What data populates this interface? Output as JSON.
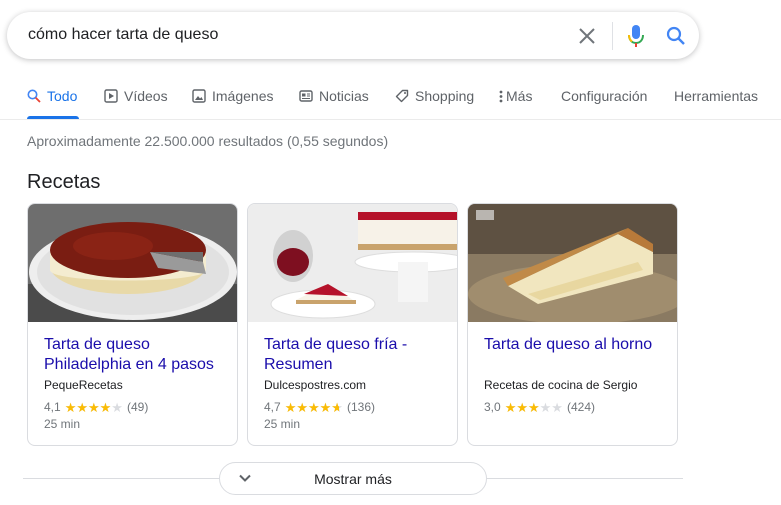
{
  "search": {
    "query": "cómo hacer tarta de queso"
  },
  "tabs": [
    {
      "label": "Todo",
      "icon": "search-icon"
    },
    {
      "label": "Vídeos",
      "icon": "play-icon"
    },
    {
      "label": "Imágenes",
      "icon": "image-icon"
    },
    {
      "label": "Noticias",
      "icon": "news-icon"
    },
    {
      "label": "Shopping",
      "icon": "tag-icon"
    },
    {
      "label": "Más",
      "icon": "more-vert-icon"
    },
    {
      "label": "Configuración"
    },
    {
      "label": "Herramientas"
    }
  ],
  "results_stats": "Aproximadamente 22.500.000 resultados (0,55 segundos)",
  "recipes": {
    "title": "Recetas",
    "cards": [
      {
        "title": "Tarta de queso Philadelphia en 4 pasos",
        "source": "PequeRecetas",
        "rating": "4,1",
        "rating_value": 4.1,
        "reviews": "(49)",
        "time": "25 min"
      },
      {
        "title": "Tarta de queso fría - Resumen",
        "source": "Dulcespostres.com",
        "rating": "4,7",
        "rating_value": 4.7,
        "reviews": "(136)",
        "time": "25 min"
      },
      {
        "title": "Tarta de queso al horno",
        "source": "Recetas de cocina de Sergio",
        "rating": "3,0",
        "rating_value": 3.0,
        "reviews": "(424)",
        "time": ""
      }
    ]
  },
  "show_more_label": "Mostrar más",
  "colors": {
    "accent": "#1a73e8",
    "link": "#1a0dab",
    "star": "#fbbc04"
  }
}
